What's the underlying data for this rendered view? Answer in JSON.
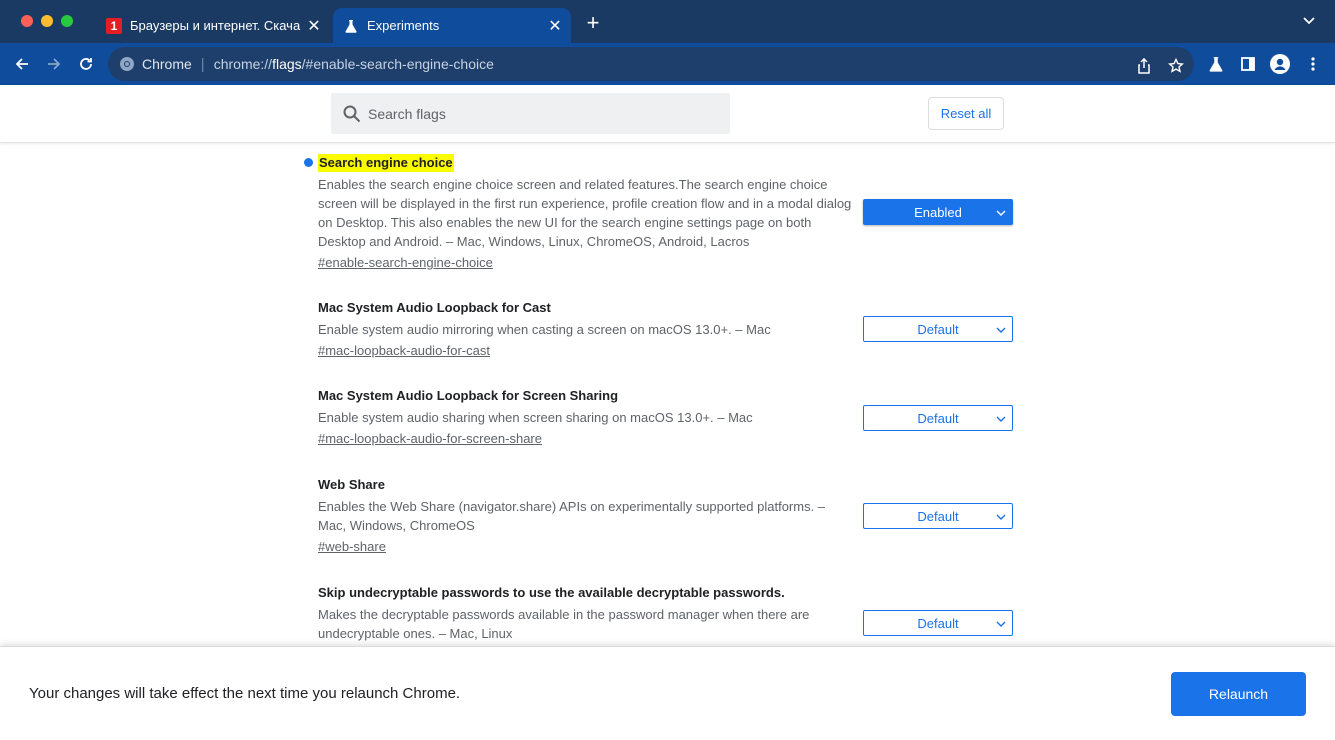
{
  "tabs": [
    {
      "title": "Браузеры и интернет. Скача",
      "favicon": "1",
      "active": false
    },
    {
      "title": "Experiments",
      "active": true
    }
  ],
  "omnibox": {
    "site": "Chrome",
    "url_prefix": "chrome://",
    "url_host": "flags",
    "url_fragment": "/#enable-search-engine-choice"
  },
  "search": {
    "placeholder": "Search flags",
    "value": ""
  },
  "reset_label": "Reset all",
  "flags": [
    {
      "title": "Search engine choice",
      "description": "Enables the search engine choice screen and related features.The search engine choice screen will be displayed in the first run experience, profile creation flow and in a modal dialog on Desktop. This also enables the new UI for the search engine settings page on both Desktop and Android. – Mac, Windows, Linux, ChromeOS, Android, Lacros",
      "link": "#enable-search-engine-choice",
      "value": "Enabled"
    },
    {
      "title": "Mac System Audio Loopback for Cast",
      "description": "Enable system audio mirroring when casting a screen on macOS 13.0+. – Mac",
      "link": "#mac-loopback-audio-for-cast",
      "value": "Default"
    },
    {
      "title": "Mac System Audio Loopback for Screen Sharing",
      "description": "Enable system audio sharing when screen sharing on macOS 13.0+. – Mac",
      "link": "#mac-loopback-audio-for-screen-share",
      "value": "Default"
    },
    {
      "title": "Web Share",
      "description": "Enables the Web Share (navigator.share) APIs on experimentally supported platforms. – Mac, Windows, ChromeOS",
      "link": "#web-share",
      "value": "Default"
    },
    {
      "title": "Skip undecryptable passwords to use the available decryptable passwords.",
      "description": "Makes the decryptable passwords available in the password manager when there are undecryptable ones. – Mac, Linux",
      "link": "",
      "value": "Default"
    }
  ],
  "footer": {
    "message": "Your changes will take effect the next time you relaunch Chrome.",
    "relaunch_label": "Relaunch"
  },
  "colors": {
    "accent": "#1a73e8",
    "tabstrip": "#1a3a63",
    "toolbar": "#0f4c9c",
    "highlight": "#fbfb00"
  }
}
